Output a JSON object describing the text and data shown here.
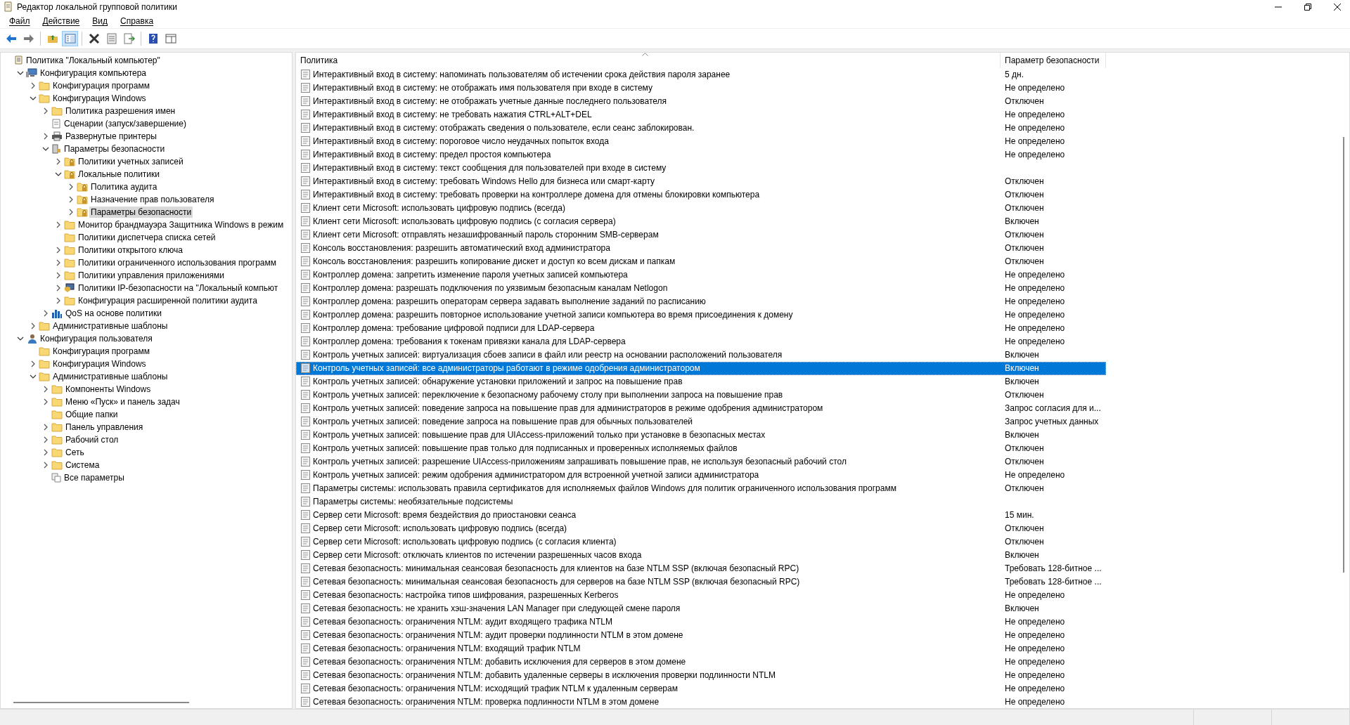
{
  "window": {
    "title": "Редактор локальной групповой политики"
  },
  "menu": [
    "Файл",
    "Действие",
    "Вид",
    "Справка"
  ],
  "toolbar": [
    {
      "kind": "back"
    },
    {
      "kind": "forward"
    },
    {
      "kind": "sep"
    },
    {
      "kind": "up"
    },
    {
      "kind": "tree",
      "selected": true
    },
    {
      "kind": "sep"
    },
    {
      "kind": "delete"
    },
    {
      "kind": "properties"
    },
    {
      "kind": "export"
    },
    {
      "kind": "sep"
    },
    {
      "kind": "help"
    },
    {
      "kind": "view"
    }
  ],
  "tree": [
    {
      "label": "Политика \"Локальный компьютер\"",
      "kind": "policy",
      "selected": false,
      "children": [
        {
          "label": "Конфигурация компьютера",
          "kind": "computer",
          "expanded": true,
          "selected": false,
          "children": [
            {
              "label": "Конфигурация программ",
              "kind": "folder",
              "expanded": false,
              "selected": false
            },
            {
              "label": "Конфигурация Windows",
              "kind": "folder",
              "expanded": true,
              "selected": false,
              "children": [
                {
                  "label": "Политика разрешения имен",
                  "kind": "folder",
                  "expanded": false,
                  "selected": false
                },
                {
                  "label": "Сценарии (запуск/завершение)",
                  "kind": "script",
                  "selected": false
                },
                {
                  "label": "Развернутые принтеры",
                  "kind": "printer",
                  "expanded": false,
                  "selected": false
                },
                {
                  "label": "Параметры безопасности",
                  "kind": "security",
                  "expanded": true,
                  "selected": false,
                  "children": [
                    {
                      "label": "Политики учетных записей",
                      "kind": "lockfolder",
                      "expanded": false,
                      "selected": false
                    },
                    {
                      "label": "Локальные политики",
                      "kind": "lockfolder",
                      "expanded": true,
                      "selected": false,
                      "children": [
                        {
                          "label": "Политика аудита",
                          "kind": "lockfolder",
                          "expanded": false,
                          "selected": false
                        },
                        {
                          "label": "Назначение прав пользователя",
                          "kind": "lockfolder",
                          "expanded": false,
                          "selected": false
                        },
                        {
                          "label": "Параметры безопасности",
                          "kind": "lockfolder",
                          "expanded": false,
                          "selected": true
                        }
                      ]
                    },
                    {
                      "label": "Монитор брандмауэра Защитника Windows в режим",
                      "kind": "folder",
                      "expanded": false,
                      "selected": false
                    },
                    {
                      "label": "Политики диспетчера списка сетей",
                      "kind": "folder",
                      "selected": false
                    },
                    {
                      "label": "Политики открытого ключа",
                      "kind": "folder",
                      "expanded": false,
                      "selected": false
                    },
                    {
                      "label": "Политики ограниченного использования программ",
                      "kind": "folder",
                      "expanded": false,
                      "selected": false
                    },
                    {
                      "label": "Политики управления приложениями",
                      "kind": "folder",
                      "expanded": false,
                      "selected": false
                    },
                    {
                      "label": "Политики IP-безопасности на \"Локальный компьют",
                      "kind": "ip",
                      "expanded": false,
                      "selected": false
                    },
                    {
                      "label": "Конфигурация расширенной политики аудита",
                      "kind": "folder",
                      "expanded": false,
                      "selected": false
                    }
                  ]
                },
                {
                  "label": "QoS на основе политики",
                  "kind": "chart",
                  "expanded": false,
                  "selected": false
                }
              ]
            },
            {
              "label": "Административные шаблоны",
              "kind": "folder",
              "expanded": false,
              "selected": false
            }
          ]
        },
        {
          "label": "Конфигурация пользователя",
          "kind": "user",
          "expanded": true,
          "selected": false,
          "children": [
            {
              "label": "Конфигурация программ",
              "kind": "folder",
              "selected": false
            },
            {
              "label": "Конфигурация Windows",
              "kind": "folder",
              "expanded": false,
              "selected": false
            },
            {
              "label": "Административные шаблоны",
              "kind": "folder",
              "expanded": true,
              "selected": false,
              "children": [
                {
                  "label": "Компоненты Windows",
                  "kind": "folder",
                  "expanded": false,
                  "selected": false
                },
                {
                  "label": "Меню «Пуск» и панель задач",
                  "kind": "folder",
                  "expanded": false,
                  "selected": false
                },
                {
                  "label": "Общие папки",
                  "kind": "folder",
                  "selected": false
                },
                {
                  "label": "Панель управления",
                  "kind": "folder",
                  "expanded": false,
                  "selected": false
                },
                {
                  "label": "Рабочий стол",
                  "kind": "folder",
                  "expanded": false,
                  "selected": false
                },
                {
                  "label": "Сеть",
                  "kind": "folder",
                  "expanded": false,
                  "selected": false
                },
                {
                  "label": "Система",
                  "kind": "folder",
                  "expanded": false,
                  "selected": false
                },
                {
                  "label": "Все параметры",
                  "kind": "settings",
                  "selected": false
                }
              ]
            }
          ]
        }
      ]
    }
  ],
  "table": {
    "columns": [
      "Политика",
      "Параметр безопасности"
    ],
    "rows": [
      {
        "policy": "Интерактивный вход в систему: напоминать пользователям об истечении срока действия пароля заранее",
        "setting": "5 дн.",
        "selected": false
      },
      {
        "policy": "Интерактивный вход в систему: не отображать имя пользователя при входе в систему",
        "setting": "Не определено",
        "selected": false
      },
      {
        "policy": "Интерактивный вход в систему: не отображать учетные данные последнего пользователя",
        "setting": "Отключен",
        "selected": false
      },
      {
        "policy": "Интерактивный вход в систему: не требовать нажатия CTRL+ALT+DEL",
        "setting": "Не определено",
        "selected": false
      },
      {
        "policy": "Интерактивный вход в систему: отображать сведения о пользователе, если сеанс заблокирован.",
        "setting": "Не определено",
        "selected": false
      },
      {
        "policy": "Интерактивный вход в систему: пороговое число неудачных попыток входа",
        "setting": "Не определено",
        "selected": false
      },
      {
        "policy": "Интерактивный вход в систему: предел простоя компьютера",
        "setting": "Не определено",
        "selected": false
      },
      {
        "policy": "Интерактивный вход в систему: текст сообщения для пользователей при входе в систему",
        "selected": false
      },
      {
        "policy": "Интерактивный вход в систему: требовать Windows Hello для бизнеса или смарт-карту",
        "setting": "Отключен",
        "selected": false
      },
      {
        "policy": "Интерактивный вход в систему: требовать проверки на контроллере домена для отмены блокировки компьютера",
        "setting": "Отключен",
        "selected": false
      },
      {
        "policy": "Клиент сети Microsoft: использовать цифровую подпись (всегда)",
        "setting": "Отключен",
        "selected": false
      },
      {
        "policy": "Клиент сети Microsoft: использовать цифровую подпись (с согласия сервера)",
        "setting": "Включен",
        "selected": false
      },
      {
        "policy": "Клиент сети Microsoft: отправлять незашифрованный пароль сторонним SMB-серверам",
        "setting": "Отключен",
        "selected": false
      },
      {
        "policy": "Консоль восстановления: разрешить автоматический вход администратора",
        "setting": "Отключен",
        "selected": false
      },
      {
        "policy": "Консоль восстановления: разрешить копирование дискет и доступ ко всем дискам и папкам",
        "setting": "Отключен",
        "selected": false
      },
      {
        "policy": "Контроллер домена: запретить изменение пароля учетных записей компьютера",
        "setting": "Не определено",
        "selected": false
      },
      {
        "policy": "Контроллер домена: разрешать подключения по уязвимым безопасным каналам Netlogon",
        "setting": "Не определено",
        "selected": false
      },
      {
        "policy": "Контроллер домена: разрешить операторам сервера задавать выполнение заданий по расписанию",
        "setting": "Не определено",
        "selected": false
      },
      {
        "policy": "Контроллер домена: разрешить повторное использование учетной записи компьютера во время присоединения к домену",
        "setting": "Не определено",
        "selected": false
      },
      {
        "policy": "Контроллер домена: требование цифровой подписи для LDAP-сервера",
        "setting": "Не определено",
        "selected": false
      },
      {
        "policy": "Контроллер домена: требования к токенам привязки канала для LDAP-сервера",
        "setting": "Не определено",
        "selected": false
      },
      {
        "policy": "Контроль учетных записей: виртуализация сбоев записи в файл или реестр на основании расположений пользователя",
        "setting": "Включен",
        "selected": false
      },
      {
        "policy": "Контроль учетных записей: все администраторы работают в режиме одобрения администратором",
        "setting": "Включен",
        "selected": true
      },
      {
        "policy": "Контроль учетных записей: обнаружение установки приложений и запрос на повышение прав",
        "setting": "Включен",
        "selected": false
      },
      {
        "policy": "Контроль учетных записей: переключение к безопасному рабочему столу при выполнении запроса на повышение прав",
        "setting": "Отключен",
        "selected": false
      },
      {
        "policy": "Контроль учетных записей: поведение запроса на повышение прав для администраторов в режиме одобрения администратором",
        "setting": "Запрос согласия для и...",
        "selected": false
      },
      {
        "policy": "Контроль учетных записей: поведение запроса на повышение прав для обычных пользователей",
        "setting": "Запрос учетных данных",
        "selected": false
      },
      {
        "policy": "Контроль учетных записей: повышение прав для UIAccess-приложений только при установке в безопасных местах",
        "setting": "Включен",
        "selected": false
      },
      {
        "policy": "Контроль учетных записей: повышение прав только для подписанных и проверенных исполняемых файлов",
        "setting": "Отключен",
        "selected": false
      },
      {
        "policy": "Контроль учетных записей: разрешение UIAccess-приложениям запрашивать повышение прав, не используя безопасный рабочий стол",
        "setting": "Отключен",
        "selected": false
      },
      {
        "policy": "Контроль учетных записей: режим одобрения администратором для встроенной учетной записи администратора",
        "setting": "Не определено",
        "selected": false
      },
      {
        "policy": "Параметры системы: использовать правила сертификатов для исполняемых файлов Windows для политик ограниченного использования программ",
        "setting": "Отключен",
        "selected": false
      },
      {
        "policy": "Параметры системы: необязательные подсистемы",
        "selected": false
      },
      {
        "policy": "Сервер сети Microsoft: время бездействия до приостановки сеанса",
        "setting": "15 мин.",
        "selected": false
      },
      {
        "policy": "Сервер сети Microsoft: использовать цифровую подпись (всегда)",
        "setting": "Отключен",
        "selected": false
      },
      {
        "policy": "Сервер сети Microsoft: использовать цифровую подпись (с согласия клиента)",
        "setting": "Отключен",
        "selected": false
      },
      {
        "policy": "Сервер сети Microsoft: отключать клиентов по истечении разрешенных часов входа",
        "setting": "Включен",
        "selected": false
      },
      {
        "policy": "Сетевая безопасность: минимальная сеансовая безопасность для клиентов на базе NTLM SSP (включая безопасный RPC)",
        "setting": "Требовать 128-битное ...",
        "selected": false
      },
      {
        "policy": "Сетевая безопасность: минимальная сеансовая безопасность для серверов на базе NTLM SSP (включая безопасный RPC)",
        "setting": "Требовать 128-битное ...",
        "selected": false
      },
      {
        "policy": "Сетевая безопасность: настройка типов шифрования, разрешенных Kerberos",
        "setting": "Не определено",
        "selected": false
      },
      {
        "policy": "Сетевая безопасность: не хранить хэш-значения LAN Manager при следующей смене пароля",
        "setting": "Включен",
        "selected": false
      },
      {
        "policy": "Сетевая безопасность: ограничения NTLM: аудит входящего трафика NTLM",
        "setting": "Не определено",
        "selected": false
      },
      {
        "policy": "Сетевая безопасность: ограничения NTLM: аудит проверки подлинности NTLM в этом домене",
        "setting": "Не определено",
        "selected": false
      },
      {
        "policy": "Сетевая безопасность: ограничения NTLM: входящий трафик NTLM",
        "setting": "Не определено",
        "selected": false
      },
      {
        "policy": "Сетевая безопасность: ограничения NTLM: добавить исключения для серверов в этом домене",
        "setting": "Не определено",
        "selected": false
      },
      {
        "policy": "Сетевая безопасность: ограничения NTLM: добавить удаленные серверы в исключения проверки подлинности NTLM",
        "setting": "Не определено",
        "selected": false
      },
      {
        "policy": "Сетевая безопасность: ограничения NTLM: исходящий трафик NTLM к удаленным серверам",
        "setting": "Не определено",
        "selected": false
      },
      {
        "policy": "Сетевая безопасность: ограничения NTLM: проверка подлинности NTLM в этом домене",
        "setting": "Не определено",
        "selected": false
      }
    ]
  }
}
